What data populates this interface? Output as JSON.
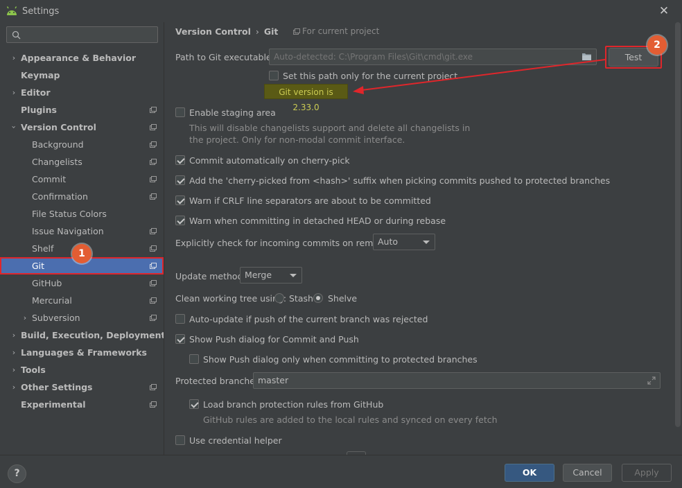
{
  "window": {
    "title": "Settings"
  },
  "search": {
    "placeholder": ""
  },
  "sidebar": {
    "items": [
      {
        "label": "Appearance & Behavior"
      },
      {
        "label": "Keymap"
      },
      {
        "label": "Editor"
      },
      {
        "label": "Plugins"
      },
      {
        "label": "Version Control"
      },
      {
        "label": "Background"
      },
      {
        "label": "Changelists"
      },
      {
        "label": "Commit"
      },
      {
        "label": "Confirmation"
      },
      {
        "label": "File Status Colors"
      },
      {
        "label": "Issue Navigation"
      },
      {
        "label": "Shelf"
      },
      {
        "label": "Git"
      },
      {
        "label": "GitHub"
      },
      {
        "label": "Mercurial"
      },
      {
        "label": "Subversion"
      },
      {
        "label": "Build, Execution, Deployment"
      },
      {
        "label": "Languages & Frameworks"
      },
      {
        "label": "Tools"
      },
      {
        "label": "Other Settings"
      },
      {
        "label": "Experimental"
      }
    ]
  },
  "breadcrumb": {
    "part1": "Version Control",
    "sep": "›",
    "part2": "Git",
    "scope": "For current project"
  },
  "git": {
    "path_label": "Path to Git executable:",
    "path_placeholder": "Auto-detected: C:\\Program Files\\Git\\cmd\\git.exe",
    "test_button": "Test",
    "set_path_project": "Set this path only for the current project",
    "version_text": "Git version is 2.33.0",
    "enable_staging": "Enable staging area",
    "staging_hint_1": "This will disable changelists support and delete all changelists in",
    "staging_hint_2": "the project. Only for non-modal commit interface.",
    "commit_cherry": "Commit automatically on cherry-pick",
    "cherry_suffix": "Add the 'cherry-picked from <hash>' suffix when picking commits pushed to protected branches",
    "warn_crlf": "Warn if CRLF line separators are about to be committed",
    "warn_detached": "Warn when committing in detached HEAD or during rebase",
    "check_incoming_label": "Explicitly check for incoming commits on remotes:",
    "check_incoming_value": "Auto",
    "update_method_label": "Update method:",
    "update_method_value": "Merge",
    "clean_tree_label": "Clean working tree using:",
    "stash_label": "Stash",
    "shelve_label": "Shelve",
    "auto_update": "Auto-update if push of the current branch was rejected",
    "show_push": "Show Push dialog for Commit and Push",
    "show_push_protected": "Show Push dialog only when committing to protected branches",
    "protected_label": "Protected branches:",
    "protected_value": "master",
    "load_rules": "Load branch protection rules from GitHub",
    "rules_hint": "GitHub rules are added to the local rules and synced on every fetch",
    "credential_helper": "Use credential helper"
  },
  "footer": {
    "help": "?",
    "ok": "OK",
    "cancel": "Cancel",
    "apply": "Apply"
  },
  "annotations": {
    "badge1": "1",
    "badge2": "2"
  },
  "colors": {
    "accent": "#4b6eaf",
    "highlight": "#e0262b",
    "badge": "#e35d33"
  }
}
